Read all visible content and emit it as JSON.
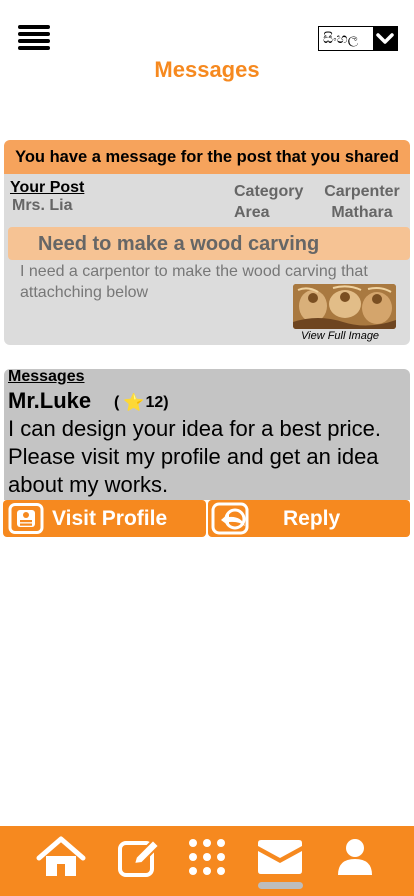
{
  "header": {
    "title": "Messages",
    "language": "සිංහල",
    "menu_icon": "hamburger-menu-icon",
    "dropdown_icon": "chevron-down-icon"
  },
  "notice": {
    "text": "You have a message for the post that you shared"
  },
  "post": {
    "section_label": "Your Post",
    "author": "Mrs. Lia",
    "category_label": "Category",
    "category_value": "Carpenter",
    "area_label": "Area",
    "area_value": "Mathara",
    "title": "Need to make a wood carving",
    "description": "I need a carpentor to make the wood carving that attachching below",
    "view_full_label": "View Full Image"
  },
  "message": {
    "section_label": "Messages",
    "sender": "Mr.Luke",
    "rating_open": "(",
    "rating_value": "12",
    "rating_close": ")",
    "body": "I can design your idea for a best price. Please visit my profile and get an idea about my works."
  },
  "actions": {
    "visit_profile_label": "Visit Profile",
    "reply_label": "Reply"
  },
  "bottom_nav": {
    "items": [
      "home-icon",
      "edit-icon",
      "grid-icon",
      "mail-icon",
      "user-icon"
    ],
    "active": "mail-icon"
  },
  "colors": {
    "accent": "#f6891f",
    "notice_bg": "#f6a35c",
    "post_bg": "#dcdcdc",
    "message_bg": "#c4c4c4"
  }
}
